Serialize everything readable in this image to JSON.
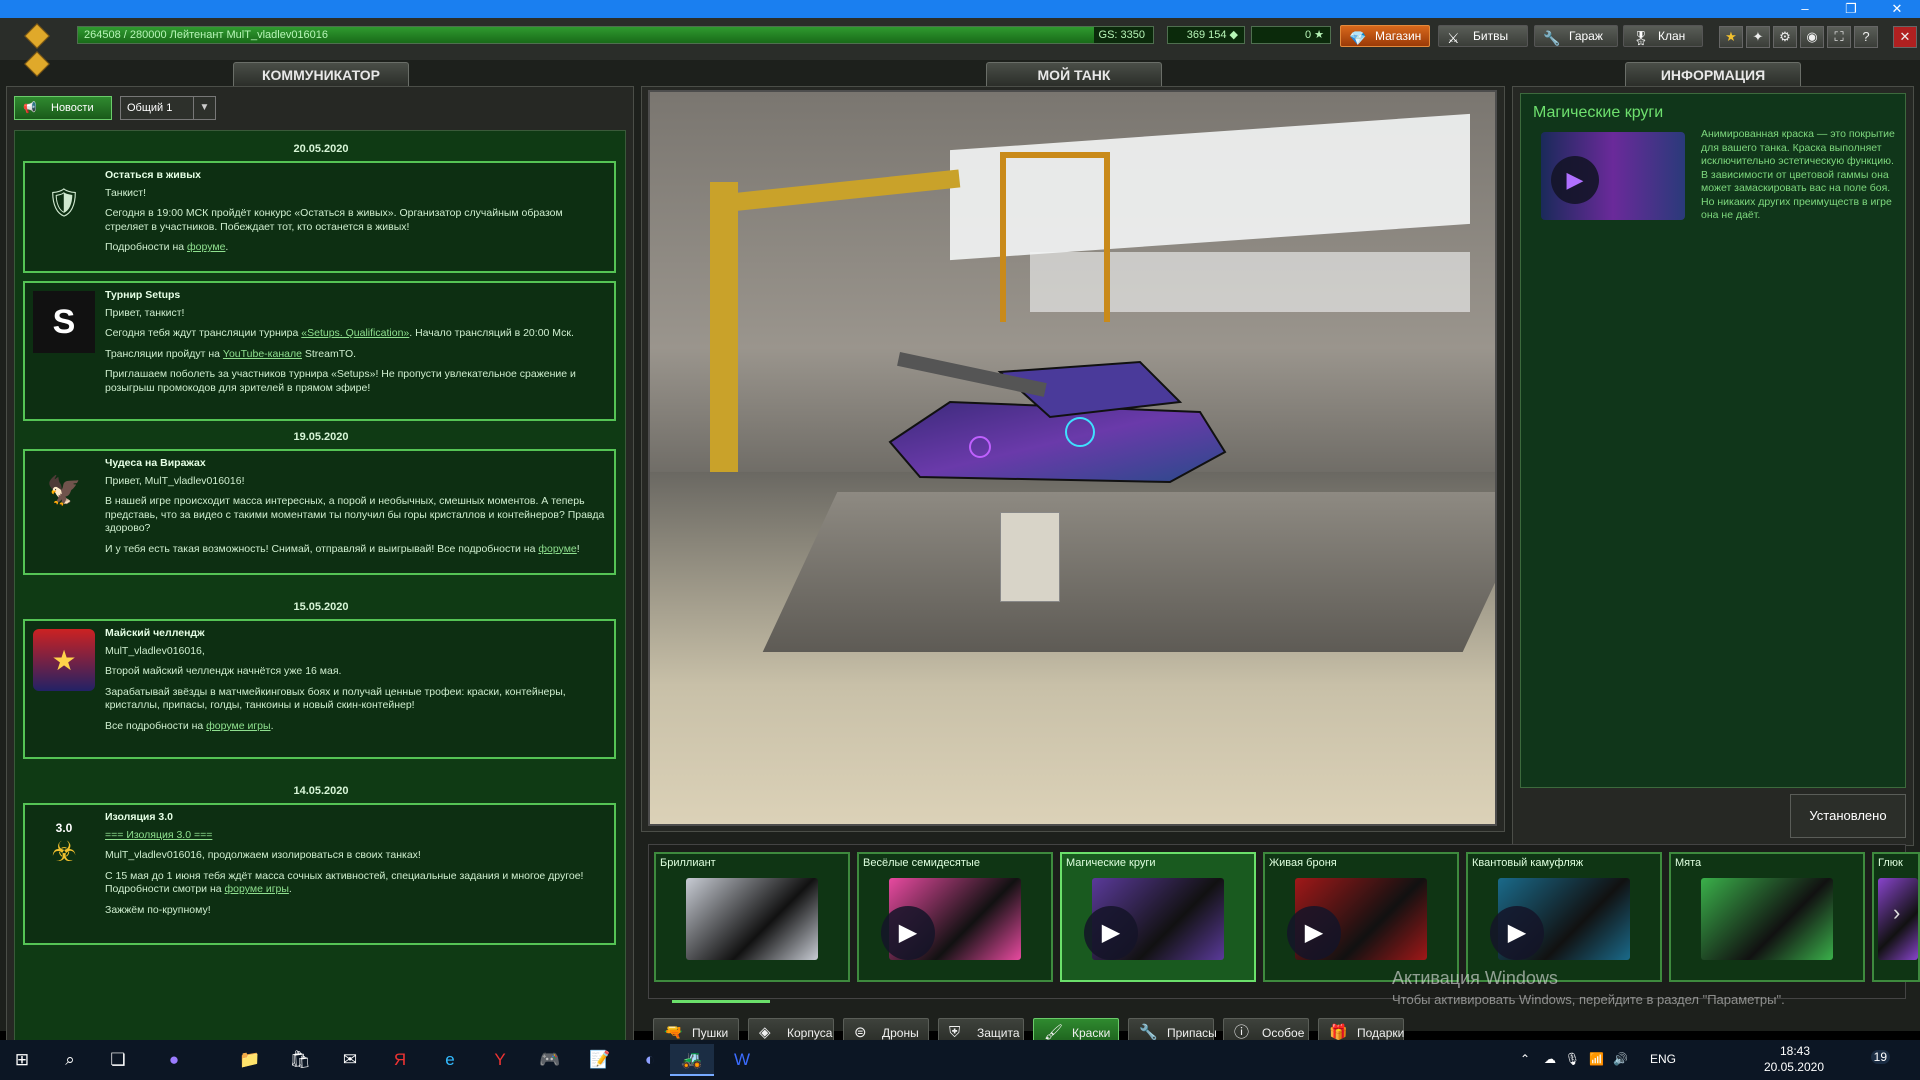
{
  "window": {
    "min": "–",
    "restore": "❐",
    "close": "✕"
  },
  "topbar": {
    "xp_text": "264508 / 280000 Лейтенант MulT_vladlev016016",
    "xp_progress": 0.945,
    "gs_text": "GS: 3350",
    "crystals": "369 154",
    "stars": "0",
    "buttons": {
      "shop": "Магазин",
      "battles": "Битвы",
      "garage": "Гараж",
      "clan": "Клан"
    }
  },
  "tabs": {
    "communicator": "КОММУНИКАТОР",
    "my_tank": "МОЙ ТАНК",
    "info": "ИНФОРМАЦИЯ"
  },
  "communicator": {
    "news_button": "Новости",
    "channel": "Общий 1",
    "dates": [
      "20.05.2020",
      "19.05.2020",
      "15.05.2020",
      "14.05.2020"
    ],
    "news": [
      {
        "title": "Остаться в живых",
        "greeting": "Танкист!",
        "p1": "Сегодня в 19:00 МСК пройдёт конкурс «Остаться в живых». Организатор случайным образом стреляет в участников. Побеждает тот, кто останется в живых!",
        "p2_prefix": "Подробности на ",
        "p2_link": "форуме",
        "p2_suffix": "."
      },
      {
        "title": "Турнир  Setups",
        "greeting": "Привет, танкист!",
        "p1_prefix": "Сегодня тебя ждут трансляции турнира ",
        "p1_link": "«Setups. Qualification»",
        "p1_suffix": ". Начало трансляций в 20:00 Мск.",
        "p2_prefix": "Трансляции пройдут на ",
        "p2_link": "YouTube-канале",
        "p2_suffix": " StreamTO.",
        "p3": "Приглашаем поболеть за участников турнира «Setups»! Не пропусти увлекательное сражение и розыгрыш промокодов для зрителей в прямом эфире!"
      },
      {
        "title": "Чудеса на Виражах",
        "greeting": "Привет, MulT_vladlev016016!",
        "p1": "В нашей игре происходит масса интересных, а порой и необычных, смешных моментов. А теперь представь, что за видео с такими моментами ты получил бы горы кристаллов и контейнеров? Правда здорово?",
        "p2_prefix": "И у тебя есть такая возможность! Снимай, отправляй и выигрывай! Все подробности на ",
        "p2_link": "форуме",
        "p2_suffix": "!"
      },
      {
        "title": "Майский челлендж",
        "greeting": "MulT_vladlev016016,",
        "p1": "Второй майский челлендж начнётся уже 16 мая.",
        "p2": "Зарабатывай звёзды в матчмейкинговых боях и получай ценные трофеи: краски, контейнеры, кристаллы, припасы, голды, танкоины и новый скин-контейнер!",
        "p3_prefix": "Все подробности на ",
        "p3_link": "форуме игры",
        "p3_suffix": "."
      },
      {
        "title": "Изоляция 3.0",
        "badge": "3.0",
        "subtitle_link": "=== Изоляция 3.0 ===",
        "greeting": "MulT_vladlev016016, продолжаем изолироваться в своих танках!",
        "p1": "С 15 мая до 1 июня тебя ждёт масса сочных активностей, специальные задания и многое другое!",
        "p1b_prefix": "Подробности смотри на ",
        "p1b_link": "форуме игры",
        "p1b_suffix": ".",
        "p2": "Зажжём по-крупному!"
      }
    ]
  },
  "info": {
    "title": "Магические круги",
    "description": "Анимированная краска — это покрытие для вашего танка. Краска выполняет исключительно эстетическую функцию. В зависимости от цветовой гаммы она может замаскировать вас на поле боя. Но никаких других преимуществ в игре она не даёт.",
    "installed": "Установлено"
  },
  "paints": [
    {
      "name": "Бриллиант",
      "color": "#c8ccd4",
      "animated": false
    },
    {
      "name": "Весёлые семидесятые",
      "color": "#e84aa0",
      "animated": true
    },
    {
      "name": "Магические круги",
      "color": "#5a3a9a",
      "animated": true,
      "selected": true
    },
    {
      "name": "Живая броня",
      "color": "#a01818",
      "animated": true
    },
    {
      "name": "Квантовый камуфляж",
      "color": "#1a6a8a",
      "animated": true
    },
    {
      "name": "Мята",
      "color": "#3ab04a",
      "animated": false
    },
    {
      "name": "Глюк",
      "color": "#8844cc",
      "animated": false
    }
  ],
  "categories": [
    "Пушки",
    "Корпуса",
    "Дроны",
    "Защита",
    "Краски",
    "Припасы",
    "Особое",
    "Подарки"
  ],
  "selected_category": "Краски",
  "windows_activation": {
    "title": "Активация Windows",
    "text": "Чтобы активировать Windows, перейдите в раздел \"Параметры\"."
  },
  "taskbar": {
    "lang": "ENG",
    "time": "18:43",
    "date": "20.05.2020",
    "notif": "19"
  }
}
